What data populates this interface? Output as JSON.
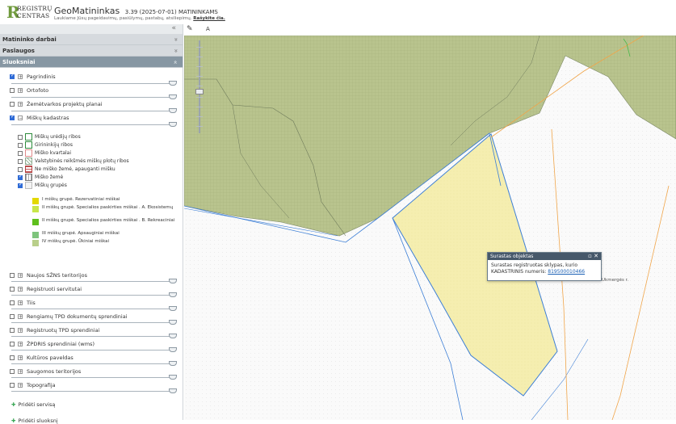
{
  "header": {
    "logo_mark": "R",
    "logo_line1": "REGISTRŲ",
    "logo_line2": "CENTRAS",
    "app_name": "GeoMatininkas",
    "version": "3.39 (2025-07-01) MATININKAMS",
    "subtitle_text": "Laukiame Jūsų pageidavimų, pasiūlymų, pastabų, atsiliepimų.",
    "subtitle_link": "Rašykite čia."
  },
  "panel": {
    "collapse_glyph": "«",
    "sections": [
      {
        "label": "Matininko darbai",
        "chevron": "»"
      },
      {
        "label": "Paslaugos",
        "chevron": "»"
      },
      {
        "label": "Sluoksniai",
        "chevron": "»"
      }
    ],
    "layers": [
      {
        "label": "Pagrindinis",
        "checked": true
      },
      {
        "label": "Ortofoto",
        "checked": false
      },
      {
        "label": "Žemėtvarkos projektų planai",
        "checked": false
      },
      {
        "label": "Miškų kadastras",
        "checked": true
      },
      {
        "label": "Naujos SŽNS teritorijos",
        "checked": false
      },
      {
        "label": "Registruoti servitutai",
        "checked": false
      },
      {
        "label": "Tiis",
        "checked": false
      },
      {
        "label": "Rengiamų TPD dokumentų sprendiniai",
        "checked": false
      },
      {
        "label": "Registruotų TPD sprendiniai",
        "checked": false
      },
      {
        "label": "ŽPDRIS sprendiniai (wms)",
        "checked": false
      },
      {
        "label": "Kultūros paveldas",
        "checked": false
      },
      {
        "label": "Saugomos teritorijos",
        "checked": false
      },
      {
        "label": "Topografija",
        "checked": false
      }
    ],
    "forest_sublayers": [
      {
        "label": "Miškų urėdijų ribos",
        "checked": false
      },
      {
        "label": "Girininkijų ribos",
        "checked": false
      },
      {
        "label": "Miško kvartalai",
        "checked": false
      },
      {
        "label": "Valstybinės reikšmės miškų plotų ribos",
        "checked": false
      },
      {
        "label": "Ne miško žemė, apauganti mišku",
        "checked": false
      },
      {
        "label": "Miško žemė",
        "checked": true
      },
      {
        "label": "Miškų grupės",
        "checked": true
      }
    ],
    "forest_groups": [
      {
        "label": "I miškų grupė. Rezervatiniai miškai",
        "color": "#e3d800"
      },
      {
        "label": "II miškų grupė. Specialios paskirties miškai . A. Ekosistemų",
        "color": "#c8e64a"
      },
      {
        "label": "II miškų grupė. Specialios paskirties miškai . B. Rekreaciniai",
        "color": "#5fbf1c"
      },
      {
        "label": "III miškų grupė. Apsauginiai miškai",
        "color": "#7ec47c"
      },
      {
        "label": "IV miškų grupė. Ūkiniai miškai",
        "color": "#b9cf8a"
      }
    ],
    "add_service": "Pridėti servisą",
    "add_layer": "Pridėti sluoksnį"
  },
  "map": {
    "toolbar_pen": "✎",
    "toolbar_label": "A",
    "place_label": "Ukmergės r.",
    "forest_color": "#b9c48e",
    "parcel_color": "#f5eeb0",
    "popup": {
      "title": "Surastas objektas",
      "controls": "▫ ✕",
      "text": "Surastas registruotas sklypas, kurio KADASTRINIS numeris:",
      "cadastral_number": "819500010466"
    }
  }
}
